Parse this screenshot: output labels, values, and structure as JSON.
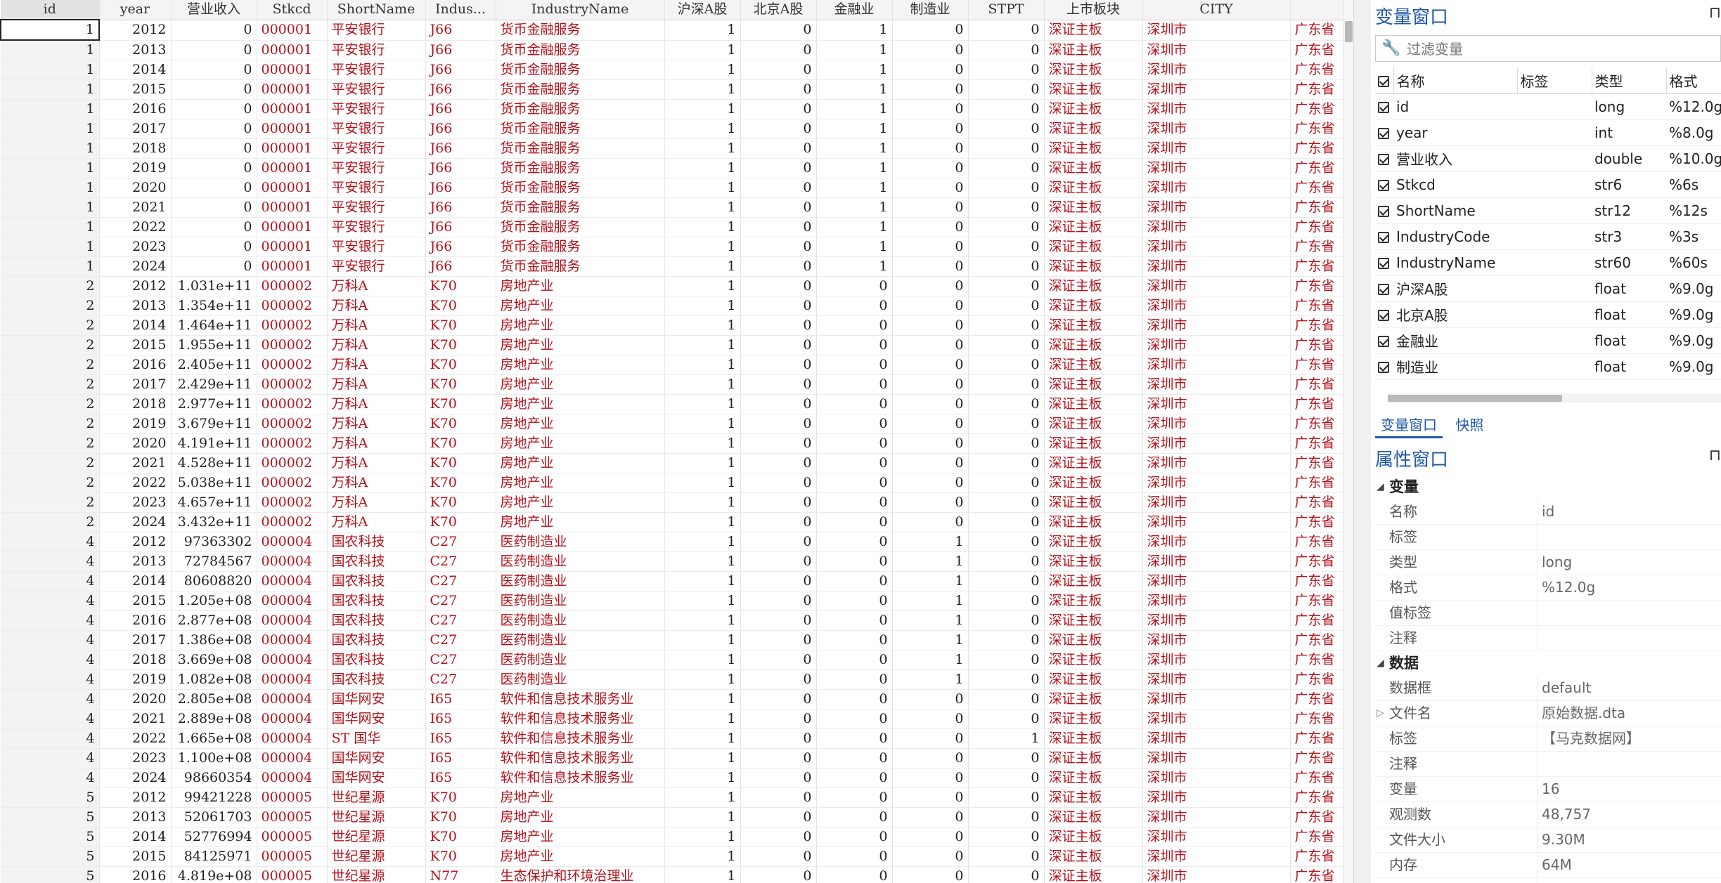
{
  "grid": {
    "columns": [
      "id",
      "year",
      "营业收入",
      "Stkcd",
      "ShortName",
      "Indus...",
      "IndustryName",
      "沪深A股",
      "北京A股",
      "金融业",
      "制造业",
      "STPT",
      "上市板块",
      "CITY",
      ""
    ],
    "rows": [
      [
        "1",
        "2012",
        "0",
        "000001",
        "平安银行",
        "J66",
        "货币金融服务",
        "1",
        "0",
        "1",
        "0",
        "0",
        "深证主板",
        "深圳市",
        "广东省"
      ],
      [
        "1",
        "2013",
        "0",
        "000001",
        "平安银行",
        "J66",
        "货币金融服务",
        "1",
        "0",
        "1",
        "0",
        "0",
        "深证主板",
        "深圳市",
        "广东省"
      ],
      [
        "1",
        "2014",
        "0",
        "000001",
        "平安银行",
        "J66",
        "货币金融服务",
        "1",
        "0",
        "1",
        "0",
        "0",
        "深证主板",
        "深圳市",
        "广东省"
      ],
      [
        "1",
        "2015",
        "0",
        "000001",
        "平安银行",
        "J66",
        "货币金融服务",
        "1",
        "0",
        "1",
        "0",
        "0",
        "深证主板",
        "深圳市",
        "广东省"
      ],
      [
        "1",
        "2016",
        "0",
        "000001",
        "平安银行",
        "J66",
        "货币金融服务",
        "1",
        "0",
        "1",
        "0",
        "0",
        "深证主板",
        "深圳市",
        "广东省"
      ],
      [
        "1",
        "2017",
        "0",
        "000001",
        "平安银行",
        "J66",
        "货币金融服务",
        "1",
        "0",
        "1",
        "0",
        "0",
        "深证主板",
        "深圳市",
        "广东省"
      ],
      [
        "1",
        "2018",
        "0",
        "000001",
        "平安银行",
        "J66",
        "货币金融服务",
        "1",
        "0",
        "1",
        "0",
        "0",
        "深证主板",
        "深圳市",
        "广东省"
      ],
      [
        "1",
        "2019",
        "0",
        "000001",
        "平安银行",
        "J66",
        "货币金融服务",
        "1",
        "0",
        "1",
        "0",
        "0",
        "深证主板",
        "深圳市",
        "广东省"
      ],
      [
        "1",
        "2020",
        "0",
        "000001",
        "平安银行",
        "J66",
        "货币金融服务",
        "1",
        "0",
        "1",
        "0",
        "0",
        "深证主板",
        "深圳市",
        "广东省"
      ],
      [
        "1",
        "2021",
        "0",
        "000001",
        "平安银行",
        "J66",
        "货币金融服务",
        "1",
        "0",
        "1",
        "0",
        "0",
        "深证主板",
        "深圳市",
        "广东省"
      ],
      [
        "1",
        "2022",
        "0",
        "000001",
        "平安银行",
        "J66",
        "货币金融服务",
        "1",
        "0",
        "1",
        "0",
        "0",
        "深证主板",
        "深圳市",
        "广东省"
      ],
      [
        "1",
        "2023",
        "0",
        "000001",
        "平安银行",
        "J66",
        "货币金融服务",
        "1",
        "0",
        "1",
        "0",
        "0",
        "深证主板",
        "深圳市",
        "广东省"
      ],
      [
        "1",
        "2024",
        "0",
        "000001",
        "平安银行",
        "J66",
        "货币金融服务",
        "1",
        "0",
        "1",
        "0",
        "0",
        "深证主板",
        "深圳市",
        "广东省"
      ],
      [
        "2",
        "2012",
        "1.031e+11",
        "000002",
        "万科A",
        "K70",
        "房地产业",
        "1",
        "0",
        "0",
        "0",
        "0",
        "深证主板",
        "深圳市",
        "广东省"
      ],
      [
        "2",
        "2013",
        "1.354e+11",
        "000002",
        "万科A",
        "K70",
        "房地产业",
        "1",
        "0",
        "0",
        "0",
        "0",
        "深证主板",
        "深圳市",
        "广东省"
      ],
      [
        "2",
        "2014",
        "1.464e+11",
        "000002",
        "万科A",
        "K70",
        "房地产业",
        "1",
        "0",
        "0",
        "0",
        "0",
        "深证主板",
        "深圳市",
        "广东省"
      ],
      [
        "2",
        "2015",
        "1.955e+11",
        "000002",
        "万科A",
        "K70",
        "房地产业",
        "1",
        "0",
        "0",
        "0",
        "0",
        "深证主板",
        "深圳市",
        "广东省"
      ],
      [
        "2",
        "2016",
        "2.405e+11",
        "000002",
        "万科A",
        "K70",
        "房地产业",
        "1",
        "0",
        "0",
        "0",
        "0",
        "深证主板",
        "深圳市",
        "广东省"
      ],
      [
        "2",
        "2017",
        "2.429e+11",
        "000002",
        "万科A",
        "K70",
        "房地产业",
        "1",
        "0",
        "0",
        "0",
        "0",
        "深证主板",
        "深圳市",
        "广东省"
      ],
      [
        "2",
        "2018",
        "2.977e+11",
        "000002",
        "万科A",
        "K70",
        "房地产业",
        "1",
        "0",
        "0",
        "0",
        "0",
        "深证主板",
        "深圳市",
        "广东省"
      ],
      [
        "2",
        "2019",
        "3.679e+11",
        "000002",
        "万科A",
        "K70",
        "房地产业",
        "1",
        "0",
        "0",
        "0",
        "0",
        "深证主板",
        "深圳市",
        "广东省"
      ],
      [
        "2",
        "2020",
        "4.191e+11",
        "000002",
        "万科A",
        "K70",
        "房地产业",
        "1",
        "0",
        "0",
        "0",
        "0",
        "深证主板",
        "深圳市",
        "广东省"
      ],
      [
        "2",
        "2021",
        "4.528e+11",
        "000002",
        "万科A",
        "K70",
        "房地产业",
        "1",
        "0",
        "0",
        "0",
        "0",
        "深证主板",
        "深圳市",
        "广东省"
      ],
      [
        "2",
        "2022",
        "5.038e+11",
        "000002",
        "万科A",
        "K70",
        "房地产业",
        "1",
        "0",
        "0",
        "0",
        "0",
        "深证主板",
        "深圳市",
        "广东省"
      ],
      [
        "2",
        "2023",
        "4.657e+11",
        "000002",
        "万科A",
        "K70",
        "房地产业",
        "1",
        "0",
        "0",
        "0",
        "0",
        "深证主板",
        "深圳市",
        "广东省"
      ],
      [
        "2",
        "2024",
        "3.432e+11",
        "000002",
        "万科A",
        "K70",
        "房地产业",
        "1",
        "0",
        "0",
        "0",
        "0",
        "深证主板",
        "深圳市",
        "广东省"
      ],
      [
        "4",
        "2012",
        "97363302",
        "000004",
        "国农科技",
        "C27",
        "医药制造业",
        "1",
        "0",
        "0",
        "1",
        "0",
        "深证主板",
        "深圳市",
        "广东省"
      ],
      [
        "4",
        "2013",
        "72784567",
        "000004",
        "国农科技",
        "C27",
        "医药制造业",
        "1",
        "0",
        "0",
        "1",
        "0",
        "深证主板",
        "深圳市",
        "广东省"
      ],
      [
        "4",
        "2014",
        "80608820",
        "000004",
        "国农科技",
        "C27",
        "医药制造业",
        "1",
        "0",
        "0",
        "1",
        "0",
        "深证主板",
        "深圳市",
        "广东省"
      ],
      [
        "4",
        "2015",
        "1.205e+08",
        "000004",
        "国农科技",
        "C27",
        "医药制造业",
        "1",
        "0",
        "0",
        "1",
        "0",
        "深证主板",
        "深圳市",
        "广东省"
      ],
      [
        "4",
        "2016",
        "2.877e+08",
        "000004",
        "国农科技",
        "C27",
        "医药制造业",
        "1",
        "0",
        "0",
        "1",
        "0",
        "深证主板",
        "深圳市",
        "广东省"
      ],
      [
        "4",
        "2017",
        "1.386e+08",
        "000004",
        "国农科技",
        "C27",
        "医药制造业",
        "1",
        "0",
        "0",
        "1",
        "0",
        "深证主板",
        "深圳市",
        "广东省"
      ],
      [
        "4",
        "2018",
        "3.669e+08",
        "000004",
        "国农科技",
        "C27",
        "医药制造业",
        "1",
        "0",
        "0",
        "1",
        "0",
        "深证主板",
        "深圳市",
        "广东省"
      ],
      [
        "4",
        "2019",
        "1.082e+08",
        "000004",
        "国农科技",
        "C27",
        "医药制造业",
        "1",
        "0",
        "0",
        "1",
        "0",
        "深证主板",
        "深圳市",
        "广东省"
      ],
      [
        "4",
        "2020",
        "2.805e+08",
        "000004",
        "国华网安",
        "I65",
        "软件和信息技术服务业",
        "1",
        "0",
        "0",
        "0",
        "0",
        "深证主板",
        "深圳市",
        "广东省"
      ],
      [
        "4",
        "2021",
        "2.889e+08",
        "000004",
        "国华网安",
        "I65",
        "软件和信息技术服务业",
        "1",
        "0",
        "0",
        "0",
        "0",
        "深证主板",
        "深圳市",
        "广东省"
      ],
      [
        "4",
        "2022",
        "1.665e+08",
        "000004",
        "ST 国华",
        "I65",
        "软件和信息技术服务业",
        "1",
        "0",
        "0",
        "0",
        "1",
        "深证主板",
        "深圳市",
        "广东省"
      ],
      [
        "4",
        "2023",
        "1.100e+08",
        "000004",
        "国华网安",
        "I65",
        "软件和信息技术服务业",
        "1",
        "0",
        "0",
        "0",
        "0",
        "深证主板",
        "深圳市",
        "广东省"
      ],
      [
        "4",
        "2024",
        "98660354",
        "000004",
        "国华网安",
        "I65",
        "软件和信息技术服务业",
        "1",
        "0",
        "0",
        "0",
        "0",
        "深证主板",
        "深圳市",
        "广东省"
      ],
      [
        "5",
        "2012",
        "99421228",
        "000005",
        "世纪星源",
        "K70",
        "房地产业",
        "1",
        "0",
        "0",
        "0",
        "0",
        "深证主板",
        "深圳市",
        "广东省"
      ],
      [
        "5",
        "2013",
        "52061703",
        "000005",
        "世纪星源",
        "K70",
        "房地产业",
        "1",
        "0",
        "0",
        "0",
        "0",
        "深证主板",
        "深圳市",
        "广东省"
      ],
      [
        "5",
        "2014",
        "52776994",
        "000005",
        "世纪星源",
        "K70",
        "房地产业",
        "1",
        "0",
        "0",
        "0",
        "0",
        "深证主板",
        "深圳市",
        "广东省"
      ],
      [
        "5",
        "2015",
        "84125971",
        "000005",
        "世纪星源",
        "K70",
        "房地产业",
        "1",
        "0",
        "0",
        "0",
        "0",
        "深证主板",
        "深圳市",
        "广东省"
      ],
      [
        "5",
        "2016",
        "4.819e+08",
        "000005",
        "世纪星源",
        "N77",
        "生态保护和环境治理业",
        "1",
        "0",
        "0",
        "0",
        "0",
        "深证主板",
        "深圳市",
        "广东省"
      ]
    ]
  },
  "variables_window": {
    "title": "变量窗口",
    "filter_placeholder": "过滤变量",
    "headers": [
      "名称",
      "标签",
      "类型",
      "格式"
    ],
    "rows": [
      {
        "name": "id",
        "label": "",
        "type": "long",
        "format": "%12.0g"
      },
      {
        "name": "year",
        "label": "",
        "type": "int",
        "format": "%8.0g"
      },
      {
        "name": "营业收入",
        "label": "",
        "type": "double",
        "format": "%10.0g"
      },
      {
        "name": "Stkcd",
        "label": "",
        "type": "str6",
        "format": "%6s"
      },
      {
        "name": "ShortName",
        "label": "",
        "type": "str12",
        "format": "%12s"
      },
      {
        "name": "IndustryCode",
        "label": "",
        "type": "str3",
        "format": "%3s"
      },
      {
        "name": "IndustryName",
        "label": "",
        "type": "str60",
        "format": "%60s"
      },
      {
        "name": "沪深A股",
        "label": "",
        "type": "float",
        "format": "%9.0g"
      },
      {
        "name": "北京A股",
        "label": "",
        "type": "float",
        "format": "%9.0g"
      },
      {
        "name": "金融业",
        "label": "",
        "type": "float",
        "format": "%9.0g"
      },
      {
        "name": "制造业",
        "label": "",
        "type": "float",
        "format": "%9.0g"
      }
    ],
    "tabs": [
      "变量窗口",
      "快照"
    ]
  },
  "properties_window": {
    "title": "属性窗口",
    "sections": [
      {
        "title": "变量",
        "rows": [
          {
            "k": "名称",
            "v": "id"
          },
          {
            "k": "标签",
            "v": ""
          },
          {
            "k": "类型",
            "v": "long"
          },
          {
            "k": "格式",
            "v": "%12.0g"
          },
          {
            "k": "值标签",
            "v": ""
          },
          {
            "k": "注释",
            "v": ""
          }
        ]
      },
      {
        "title": "数据",
        "rows": [
          {
            "k": "数据框",
            "v": "default"
          },
          {
            "k": "文件名",
            "v": "原始数据.dta"
          },
          {
            "k": "标签",
            "v": "【马克数据网】"
          },
          {
            "k": "注释",
            "v": ""
          },
          {
            "k": "变量",
            "v": "16"
          },
          {
            "k": "观测数",
            "v": "48,757"
          },
          {
            "k": "文件大小",
            "v": "9.30M"
          },
          {
            "k": "内存",
            "v": "64M"
          },
          {
            "k": "排序",
            "v": ""
          }
        ]
      }
    ]
  },
  "colors": {
    "string_text": "#b3121b",
    "accent": "#1e5aa8"
  }
}
